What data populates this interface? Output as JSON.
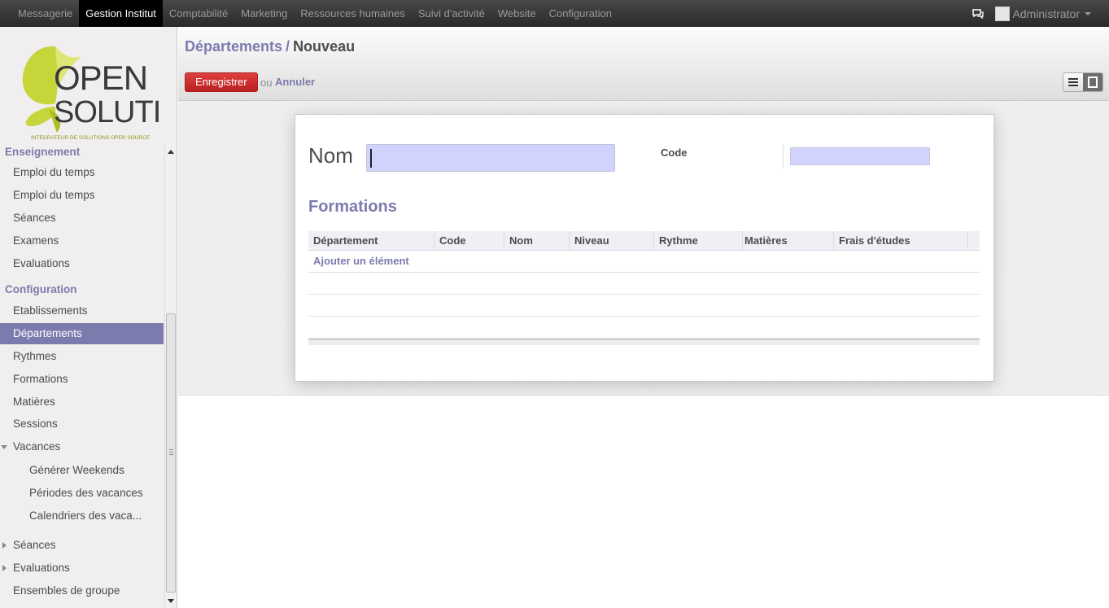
{
  "topbar": {
    "menu": [
      "Messagerie",
      "Gestion Institut",
      "Comptabilité",
      "Marketing",
      "Ressources humaines",
      "Suivi d'activité",
      "Website",
      "Configuration"
    ],
    "active_index": 1,
    "user": "Administrator"
  },
  "logo": {
    "line1": "OPEN",
    "line2": "SOLUTIS",
    "tagline": "INTEGRATEUR DE SOLUTIONS OPEN SOURCE"
  },
  "sidebar": {
    "section1": "Enseignement",
    "items1": [
      "Emploi du temps",
      "Emploi du temps",
      "Séances",
      "Examens",
      "Evaluations"
    ],
    "section2": "Configuration",
    "items2": [
      "Etablissements",
      "Départements",
      "Rythmes",
      "Formations",
      "Matières",
      "Sessions"
    ],
    "vacances": "Vacances",
    "vacances_sub": [
      "Générer Weekends",
      "Périodes des vacances",
      "Calendriers des vaca..."
    ],
    "collapsed": [
      "Séances",
      "Evaluations"
    ],
    "last": "Ensembles de groupe"
  },
  "header": {
    "breadcrumb_parent": "Départements",
    "breadcrumb_sep": "/",
    "breadcrumb_current": "Nouveau",
    "save_label": "Enregistrer",
    "or_label": "ou",
    "cancel_label": "Annuler"
  },
  "form": {
    "name_label": "Nom",
    "name_value": "",
    "code_label": "Code",
    "code_value": "",
    "formations_title": "Formations",
    "columns": [
      "Département",
      "Code",
      "Nom",
      "Niveau",
      "Rythme",
      "Matières",
      "Frais d'études"
    ],
    "add_item": "Ajouter un élément"
  },
  "colors": {
    "accent": "#7c7bad",
    "save_button": "#c02c2c",
    "input_required": "#d2d2ff"
  }
}
